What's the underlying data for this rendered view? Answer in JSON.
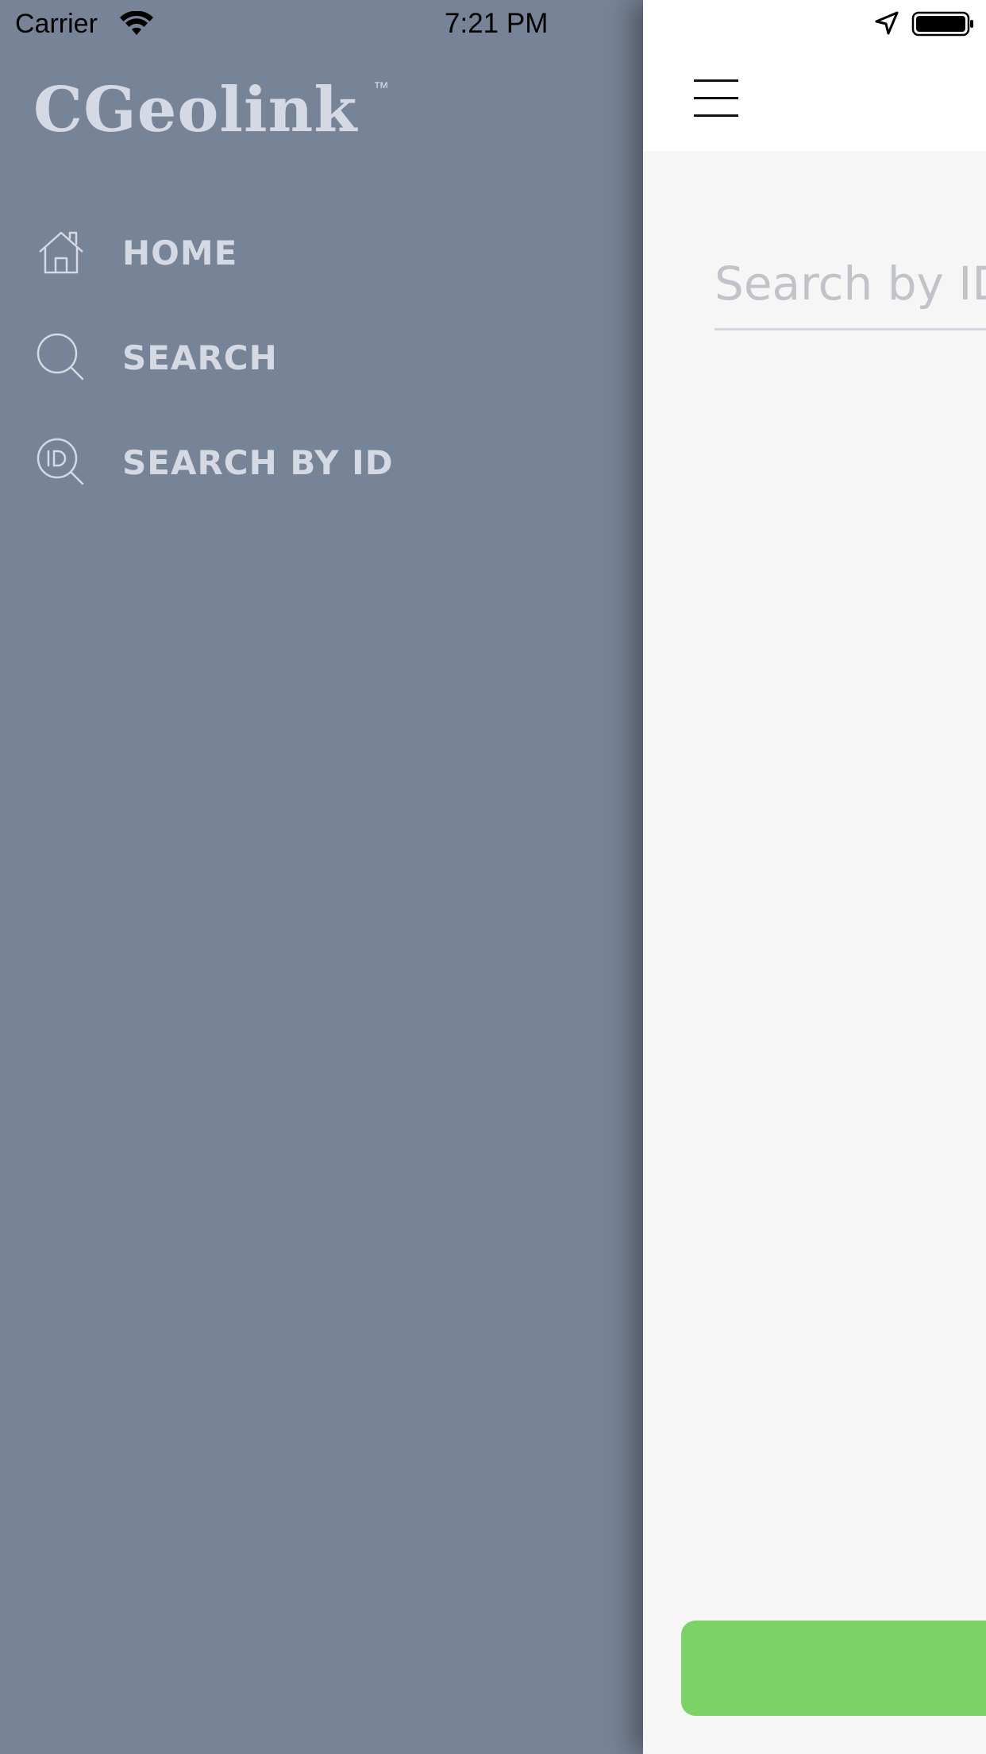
{
  "status_bar": {
    "carrier": "Carrier",
    "time": "7:21 PM",
    "wifi_icon": "wifi-icon",
    "location_icon": "location-arrow-icon",
    "battery_icon": "battery-full-icon"
  },
  "drawer": {
    "logo": "CGeolink",
    "logo_tm": "™",
    "background_color": "#778396",
    "text_color": "#d4d9e3",
    "items": [
      {
        "label": "HOME",
        "icon": "home-icon"
      },
      {
        "label": "SEARCH",
        "icon": "search-icon"
      },
      {
        "label": "SEARCH BY ID",
        "icon": "search-id-icon"
      }
    ]
  },
  "main": {
    "menu_icon": "hamburger-menu-icon",
    "search_placeholder": "Search by ID",
    "search_value": "",
    "button_color": "#7dd266",
    "button_label": ""
  }
}
